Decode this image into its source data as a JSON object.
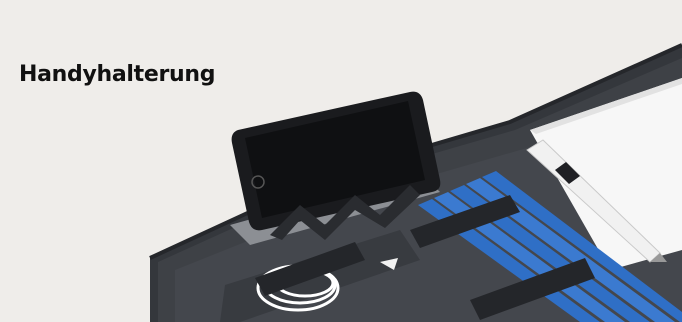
{
  "title": "Handyhalterung",
  "colors": {
    "background": "#efedea",
    "folder": "#3a3d42",
    "folder_dark": "#2b2d31",
    "phone": "#1a1b1e",
    "pencil": "#2f6fc6",
    "band": "#24262a",
    "paper": "#f7f7f7"
  },
  "objects": [
    "leather-organizer-folder-icon",
    "smartphone-icon",
    "phone-stand-icon",
    "blue-pencils-icon",
    "charging-cable-icon",
    "ballpoint-pen-icon",
    "paper-pad-icon"
  ]
}
